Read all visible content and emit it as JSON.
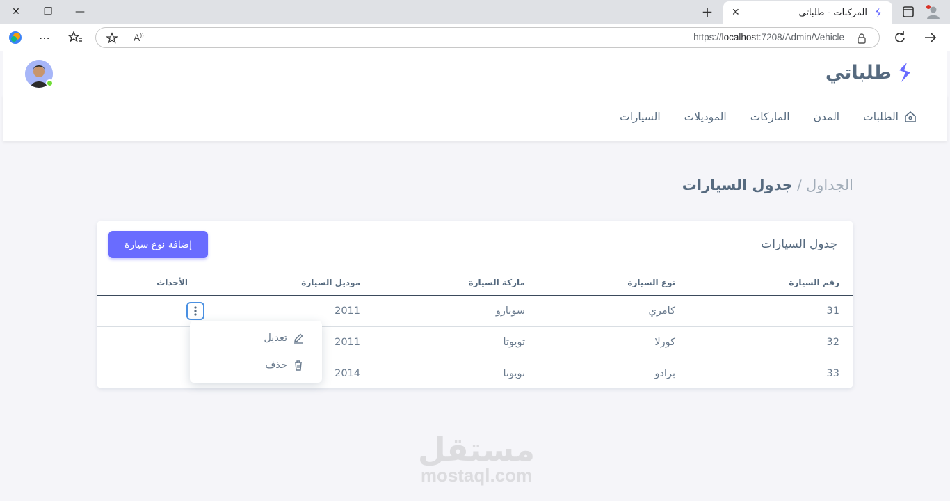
{
  "browser": {
    "tab_title": "المركبات - طلباتي",
    "url_prefix": "https://",
    "url_host": "localhost",
    "url_rest": ":7208/Admin/Vehicle"
  },
  "app": {
    "brand_name": "طلباتي",
    "accent_color": "#696cff"
  },
  "nav": {
    "items": [
      {
        "label": "الطلبات"
      },
      {
        "label": "المدن"
      },
      {
        "label": "الماركات"
      },
      {
        "label": "الموديلات"
      },
      {
        "label": "السيارات"
      }
    ]
  },
  "breadcrumb": {
    "parent": "الجداول",
    "separator": "/",
    "current": "جدول السيارات"
  },
  "card": {
    "title": "جدول السيارات",
    "add_button": "إضافة نوع سيارة"
  },
  "table": {
    "headers": [
      "رقم السيارة",
      "نوع السيارة",
      "ماركة السيارة",
      "موديل السيارة",
      "الأحداث"
    ],
    "rows": [
      {
        "id": "31",
        "type": "كامري",
        "brand": "سوبارو",
        "model": "2011"
      },
      {
        "id": "32",
        "type": "كورلا",
        "brand": "تويوتا",
        "model": "2011"
      },
      {
        "id": "33",
        "type": "برادو",
        "brand": "تويوتا",
        "model": "2014"
      }
    ]
  },
  "dropdown": {
    "edit": "تعديل",
    "delete": "حذف"
  },
  "watermark": {
    "arabic": "مستقل",
    "latin": "mostaql.com"
  }
}
